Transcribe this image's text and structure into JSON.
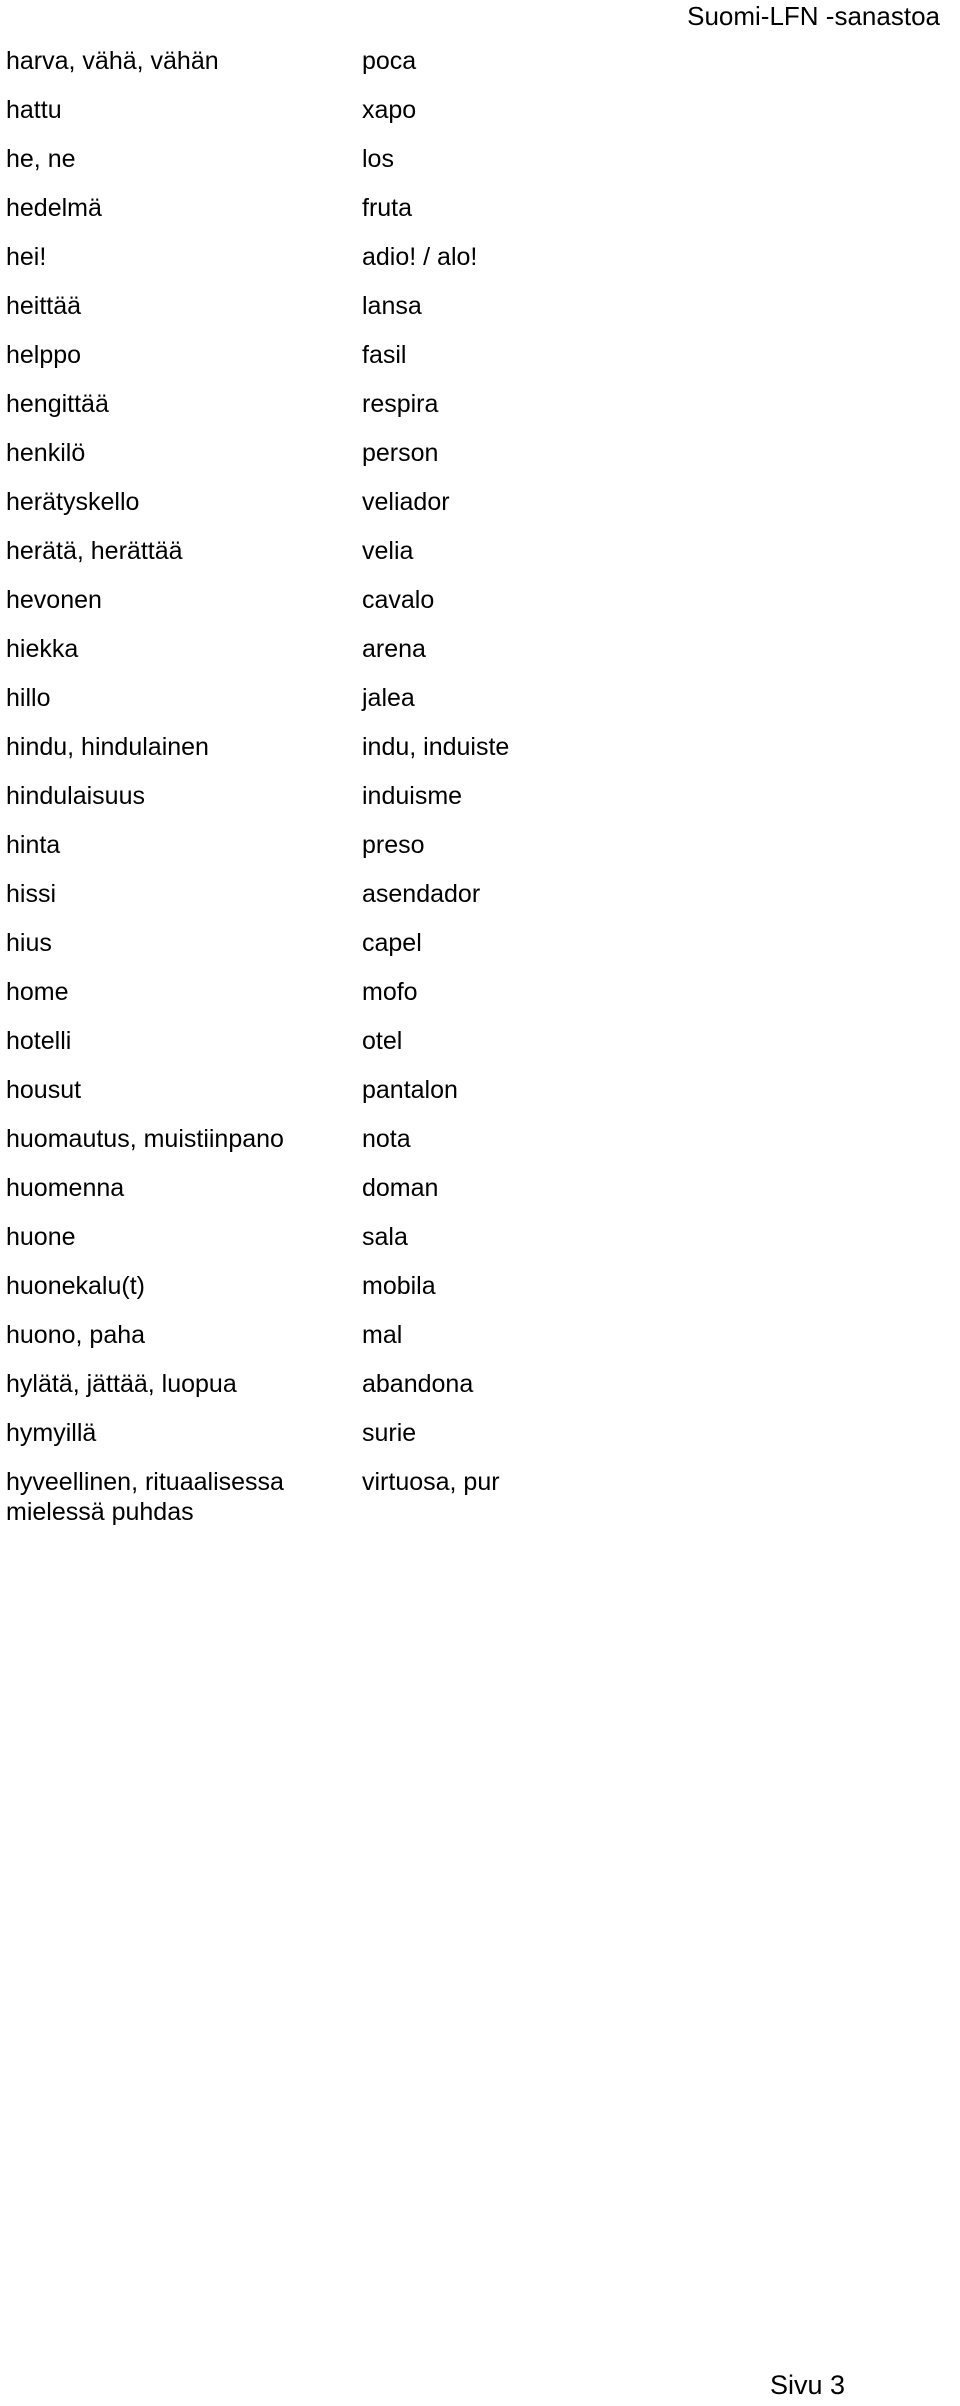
{
  "document": {
    "header_title": "Suomi-LFN -sanastoa",
    "footer_page_label": "Sivu 3"
  },
  "glossary": {
    "entries": [
      {
        "term": "harva, vähä, vähän",
        "gloss": "poca"
      },
      {
        "term": "hattu",
        "gloss": "xapo"
      },
      {
        "term": "he, ne",
        "gloss": "los"
      },
      {
        "term": "hedelmä",
        "gloss": "fruta"
      },
      {
        "term": "hei!",
        "gloss": "adio! / alo!"
      },
      {
        "term": "heittää",
        "gloss": "lansa"
      },
      {
        "term": "helppo",
        "gloss": "fasil"
      },
      {
        "term": "hengittää",
        "gloss": "respira"
      },
      {
        "term": "henkilö",
        "gloss": "person"
      },
      {
        "term": "herätyskello",
        "gloss": "veliador"
      },
      {
        "term": "herätä, herättää",
        "gloss": "velia"
      },
      {
        "term": "hevonen",
        "gloss": "cavalo"
      },
      {
        "term": "hiekka",
        "gloss": "arena"
      },
      {
        "term": "hillo",
        "gloss": "jalea"
      },
      {
        "term": "hindu, hindulainen",
        "gloss": "indu, induiste"
      },
      {
        "term": "hindulaisuus",
        "gloss": "induisme"
      },
      {
        "term": "hinta",
        "gloss": "preso"
      },
      {
        "term": "hissi",
        "gloss": "asendador"
      },
      {
        "term": "hius",
        "gloss": "capel"
      },
      {
        "term": "home",
        "gloss": "mofo"
      },
      {
        "term": "hotelli",
        "gloss": "otel"
      },
      {
        "term": "housut",
        "gloss": "pantalon"
      },
      {
        "term": "huomautus, muistiinpano",
        "gloss": "nota"
      },
      {
        "term": "huomenna",
        "gloss": "doman"
      },
      {
        "term": "huone",
        "gloss": "sala"
      },
      {
        "term": "huonekalu(t)",
        "gloss": "mobila"
      },
      {
        "term": "huono, paha",
        "gloss": "mal"
      },
      {
        "term": "hylätä, jättää, luopua",
        "gloss": "abandona"
      },
      {
        "term": "hymyillä",
        "gloss": "surie"
      },
      {
        "term": "hyveellinen, rituaalisessa mielessä puhdas",
        "gloss": "virtuosa, pur",
        "tall": true
      }
    ]
  }
}
